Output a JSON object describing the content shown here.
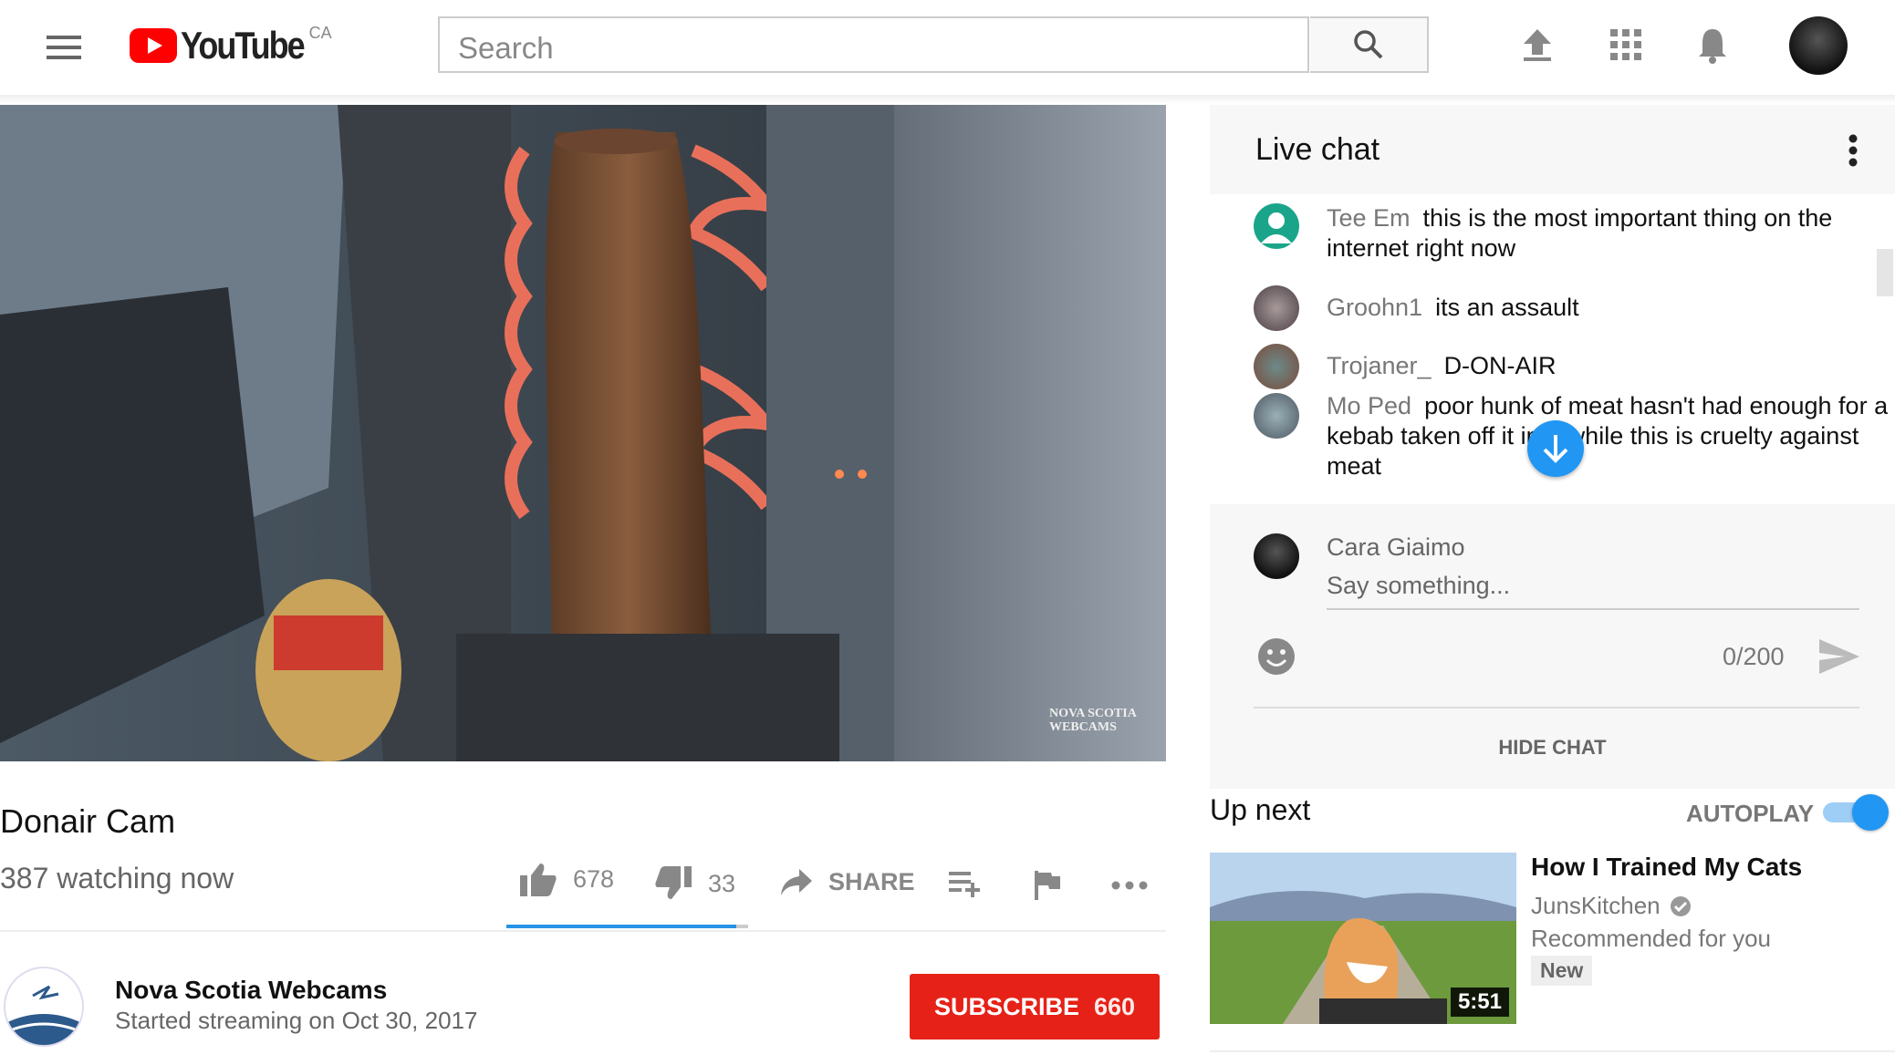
{
  "header": {
    "logo_text": "YouTube",
    "region": "CA",
    "search_placeholder": "Search"
  },
  "video": {
    "watermark": "NOVA SCOTIA WEBCAMS",
    "title": "Donair Cam",
    "watching": "387 watching now",
    "likes": "678",
    "dislikes": "33",
    "share_label": "SHARE",
    "like_ratio": 0.95
  },
  "channel": {
    "name": "Nova Scotia Webcams",
    "started": "Started streaming on Oct 30, 2017",
    "subscribe_label": "SUBSCRIBE",
    "subscribers": "660"
  },
  "chat": {
    "title": "Live chat",
    "messages": [
      {
        "author": "Tee Em",
        "text": "this is the most important thing on the internet right now"
      },
      {
        "author": "Groohn1",
        "text": "its an assault"
      },
      {
        "author": "Trojaner_",
        "text": "D-ON-AIR"
      },
      {
        "author": "Mo Ped",
        "text": "poor hunk of meat hasn't had enough for a kebab taken off it in a while this is cruelty against meat"
      }
    ],
    "current_user": "Cara Giaimo",
    "input_placeholder": "Say something...",
    "char_count": "0/200",
    "hide_label": "HIDE CHAT"
  },
  "up_next": {
    "title": "Up next",
    "autoplay_label": "AUTOPLAY",
    "autoplay_on": true,
    "video_title": "How I Trained My Cats",
    "video_channel": "JunsKitchen",
    "video_reason": "Recommended for you",
    "video_badge": "New",
    "video_duration": "5:51"
  },
  "colors": {
    "brand_red": "#ff0000",
    "subscribe_red": "#e62117",
    "accent_blue": "#2196f3",
    "progress_blue": "#2793e6"
  }
}
